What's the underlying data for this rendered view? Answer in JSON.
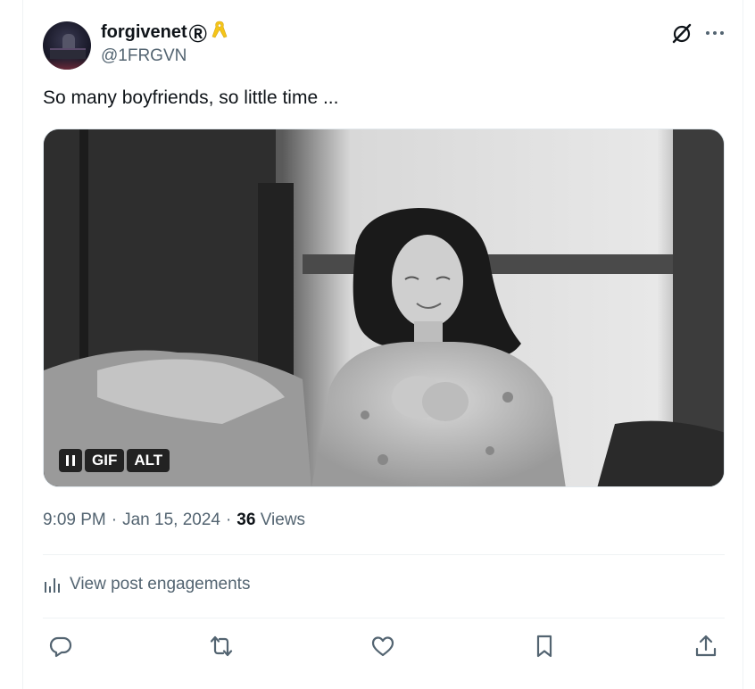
{
  "author": {
    "display_name": "forgivenet",
    "registered_mark": "Ⓡ",
    "handle": "@1FRGVN",
    "badge_icon": "yellow-ribbon-icon"
  },
  "header_actions": {
    "grok_icon": "grok-icon",
    "more_icon": "more-icon"
  },
  "tweet": {
    "text": "So many boyfriends, so little time ..."
  },
  "media": {
    "type": "gif",
    "pause_icon": "pause-icon",
    "gif_label": "GIF",
    "alt_label": "ALT"
  },
  "meta": {
    "time": "9:09 PM",
    "separator1": "·",
    "date": "Jan 15, 2024",
    "separator2": "·",
    "views_count": "36",
    "views_label": "Views"
  },
  "engagements": {
    "label": "View post engagements",
    "icon": "analytics-icon"
  },
  "actions": {
    "reply_icon": "reply-icon",
    "retweet_icon": "retweet-icon",
    "like_icon": "heart-icon",
    "bookmark_icon": "bookmark-icon",
    "share_icon": "share-icon"
  },
  "colors": {
    "text_primary": "#0f1419",
    "text_secondary": "#536471",
    "divider": "#eff3f4",
    "ribbon": "#f5c518"
  }
}
